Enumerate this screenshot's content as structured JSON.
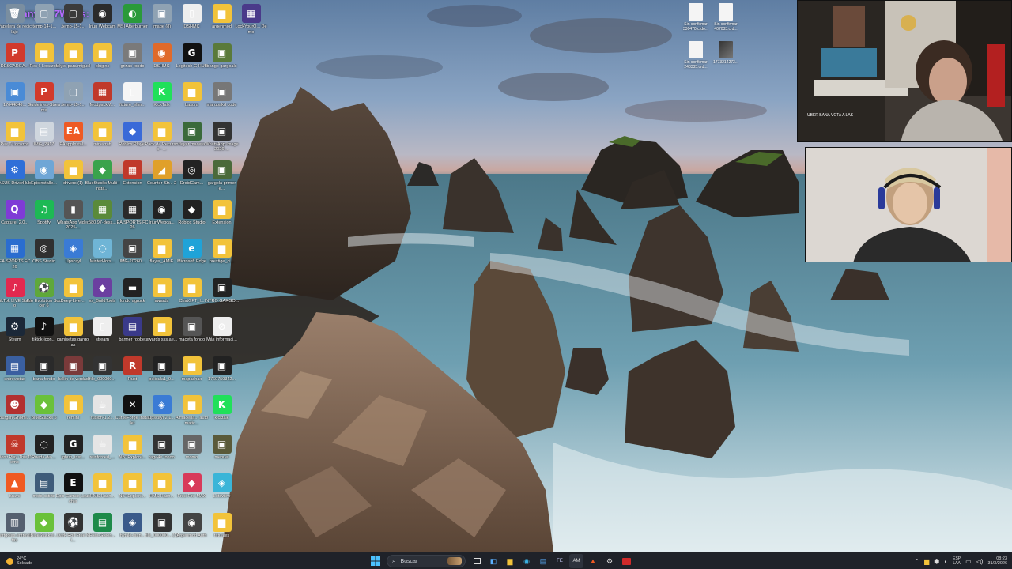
{
  "stream_overlay": {
    "title": "Danyel17Ways:"
  },
  "desktop_icons": [
    {
      "label": "Papelera de reciclaje",
      "color": "#7a8ea0",
      "glyph": "🗑"
    },
    {
      "label": "DESCARGA...",
      "color": "#d23a2c",
      "glyph": "P"
    },
    {
      "label": "17644846...",
      "color": "#4a8bd6",
      "glyph": "▣"
    },
    {
      "label": "Pes 6 Locazos",
      "color": "#f2c33a",
      "glyph": "▆"
    },
    {
      "label": "ASUS DriverHub",
      "color": "#2f6fd8",
      "glyph": "⚙"
    },
    {
      "label": "Capture_2.0...",
      "color": "#7f3bd6",
      "glyph": "Q"
    },
    {
      "label": "EA SPORTS FC 26",
      "color": "#2a6dcf",
      "glyph": "▦"
    },
    {
      "label": "TikTok LIVE Studio",
      "color": "#e2294f",
      "glyph": "♪"
    },
    {
      "label": "Steam",
      "color": "#1b2838",
      "glyph": "⚙"
    },
    {
      "label": "entrevistas",
      "color": "#3a5fa0",
      "glyph": "▤"
    },
    {
      "label": "Burglin Gnomi...",
      "color": "#b23030",
      "glyph": "☻"
    },
    {
      "label": "Don't Play This Demo",
      "color": "#c0392b",
      "glyph": "☠"
    },
    {
      "label": "Brave",
      "color": "#f05a22",
      "glyph": "▲"
    },
    {
      "label": "gartgolas entrevistas",
      "color": "#556070",
      "glyph": "▥"
    },
    {
      "label": ".temp-14-1...",
      "color": "#8fa2b3",
      "glyph": "▢"
    },
    {
      "label": "Pes 6 Locazos",
      "color": "#f2c33a",
      "glyph": "▆"
    },
    {
      "label": "Guidelines-Streams",
      "color": "#d23a2c",
      "glyph": "P"
    },
    {
      "label": "IMG_2417",
      "color": "#cfd6de",
      "glyph": "▤"
    },
    {
      "label": "EpicInstalle...",
      "color": "#6fa6d6",
      "glyph": "◉"
    },
    {
      "label": "Spotify",
      "color": "#1db954",
      "glyph": "♫"
    },
    {
      "label": "OBS Studio",
      "color": "#303030",
      "glyph": "◎"
    },
    {
      "label": "Pro Evolution Soccer 6",
      "color": "#5fa83a",
      "glyph": "⚽"
    },
    {
      "label": "tiktok-icon...",
      "color": "#111111",
      "glyph": "♪"
    },
    {
      "label": "bana fondo",
      "color": "#2a2a2a",
      "glyph": "▣"
    },
    {
      "label": "BlueStacks 5",
      "color": "#6ac13a",
      "glyph": "◆"
    },
    {
      "label": "Rueda-de-...",
      "color": "#222222",
      "glyph": "◌"
    },
    {
      "label": "mofo cstirts",
      "color": "#3f5c7a",
      "glyph": "▤"
    },
    {
      "label": "BlueStacksI...",
      "color": "#6ac13a",
      "glyph": "◆"
    },
    {
      "label": ".temp-15-1...",
      "color": "#3b3b3b",
      "glyph": "▢"
    },
    {
      "label": "falyer para miguel",
      "color": "#f2c33a",
      "glyph": "▆"
    },
    {
      "label": ".temp-15-1...",
      "color": "#8fa2b3",
      "glyph": "▢"
    },
    {
      "label": "EAappInstal...",
      "color": "#ee5a24",
      "glyph": "EA"
    },
    {
      "label": "drivers (1)",
      "color": "#f2c33a",
      "glyph": "▆"
    },
    {
      "label": "WhatsApp Video 2025-...",
      "color": "#555555",
      "glyph": "▮"
    },
    {
      "label": "Upscayl",
      "color": "#3a7bd5",
      "glyph": "◈"
    },
    {
      "label": "Deep-Live-...",
      "color": "#f2c33a",
      "glyph": "▆"
    },
    {
      "label": "camisetas gargolas",
      "color": "#f2c33a",
      "glyph": "▆"
    },
    {
      "label": "ballin de verdad",
      "color": "#7a3a3a",
      "glyph": "▣"
    },
    {
      "label": "remini",
      "color": "#f2c33a",
      "glyph": "▆"
    },
    {
      "label": "lghub_inst...",
      "color": "#222222",
      "glyph": "G"
    },
    {
      "label": "Epic Games Launcher",
      "color": "#111111",
      "glyph": "E"
    },
    {
      "label": "Dark Roll Free Ki...",
      "color": "#333333",
      "glyph": "⚽"
    },
    {
      "label": "Iriun Webcam",
      "color": "#2b2b2b",
      "glyph": "◉"
    },
    {
      "label": "plugins",
      "color": "#f2c33a",
      "glyph": "▆"
    },
    {
      "label": "ModpackM...",
      "color": "#c0392b",
      "glyph": "▦"
    },
    {
      "label": "minecraft",
      "color": "#f2c33a",
      "glyph": "▆"
    },
    {
      "label": "BlueStacks Multi-Insta...",
      "color": "#3aa34c",
      "glyph": "◆"
    },
    {
      "label": "580,97-desk...",
      "color": "#5a8a3a",
      "glyph": "▦"
    },
    {
      "label": "MinterHors...",
      "color": "#6fb5d6",
      "glyph": "◌"
    },
    {
      "label": "vs_BuildTools",
      "color": "#6b3fa0",
      "glyph": "◆"
    },
    {
      "label": "stream",
      "color": "#eeeeee",
      "glyph": "▯"
    },
    {
      "label": "file_000000...",
      "color": "#333333",
      "glyph": "▣"
    },
    {
      "label": "fusion-1.2...",
      "color": "#e5e5e5",
      "glyph": "☕"
    },
    {
      "label": "reinforced_...",
      "color": "#e5e5e5",
      "glyph": "☕"
    },
    {
      "label": "HMS.Hash...",
      "color": "#f2c33a",
      "glyph": "▆"
    },
    {
      "label": "Free-Green...",
      "color": "#1e8a4a",
      "glyph": "▤"
    },
    {
      "label": "MSI Afterburner",
      "color": "#2a9a3a",
      "glyph": "◐"
    },
    {
      "label": "grizas fondo",
      "color": "#7a7a7a",
      "glyph": "▣"
    },
    {
      "label": "fixture_elim...",
      "color": "#f5f5f5",
      "glyph": "▯"
    },
    {
      "label": "Roblox Player",
      "color": "#3a6ad8",
      "glyph": "◆"
    },
    {
      "label": "Extension",
      "color": "#c0392b",
      "glyph": "▦"
    },
    {
      "label": "EA SPORTS FC 26",
      "color": "#2a2a2a",
      "glyph": "▦"
    },
    {
      "label": "IMG-20260...",
      "color": "#444444",
      "glyph": "▣"
    },
    {
      "label": "fondo agruck",
      "color": "#222222",
      "glyph": "▬"
    },
    {
      "label": "banner roobet",
      "color": "#3a3a8a",
      "glyph": "▤"
    },
    {
      "label": "Rust",
      "color": "#c0392b",
      "glyph": "R"
    },
    {
      "label": "CurseForge Installer",
      "color": "#111111",
      "glyph": "✕"
    },
    {
      "label": "NBTExplore...",
      "color": "#f2c33a",
      "glyph": "▆"
    },
    {
      "label": "NBTExplore...",
      "color": "#f2c33a",
      "glyph": "▆"
    },
    {
      "label": "hytale-laun...",
      "color": "#3a5a8a",
      "glyph": "◈"
    },
    {
      "label": "image (8)",
      "color": "#8fa2b3",
      "glyph": "▣"
    },
    {
      "label": "DSHMC",
      "color": "#e06a2a",
      "glyph": "◉"
    },
    {
      "label": "KickTalk",
      "color": "#20e05a",
      "glyph": "K"
    },
    {
      "label": "Pack de Recursos - ...",
      "color": "#f2c33a",
      "glyph": "▆"
    },
    {
      "label": "Counter-Str... 2",
      "color": "#e0a02a",
      "glyph": "◢"
    },
    {
      "label": "IriunWebca...",
      "color": "#222222",
      "glyph": "◉"
    },
    {
      "label": "flayer_AMIE",
      "color": "#f2c33a",
      "glyph": "▆"
    },
    {
      "label": "awards",
      "color": "#f2c33a",
      "glyph": "▆"
    },
    {
      "label": "awards sss.ae...",
      "color": "#f2c33a",
      "glyph": "▆"
    },
    {
      "label": "pelicula1_9...",
      "color": "#222222",
      "glyph": "▣"
    },
    {
      "label": "upscayl-2.1...",
      "color": "#3a7bd5",
      "glyph": "◈"
    },
    {
      "label": "rage4e fondo",
      "color": "#333333",
      "glyph": "▣"
    },
    {
      "label": "HMS.Hash...",
      "color": "#f2c33a",
      "glyph": "▆"
    },
    {
      "label": "file_000000... (1)",
      "color": "#333333",
      "glyph": "▣"
    },
    {
      "label": "DSHMC",
      "color": "#eeeeee",
      "glyph": "▯"
    },
    {
      "label": "Logitech G HUB",
      "color": "#111111",
      "glyph": "G"
    },
    {
      "label": "basura",
      "color": "#f2c33a",
      "glyph": "▆"
    },
    {
      "label": "flayer maceta",
      "color": "#3a6a3a",
      "glyph": "▣"
    },
    {
      "label": "DroidCam...",
      "color": "#222222",
      "glyph": "◎"
    },
    {
      "label": "Roblox Studio",
      "color": "#222222",
      "glyph": "◆"
    },
    {
      "label": "Microsoft Edge",
      "color": "#1fa3d8",
      "glyph": "e"
    },
    {
      "label": "ChatGPT_I...",
      "color": "#f2c33a",
      "glyph": "▆"
    },
    {
      "label": "maceta fondo",
      "color": "#555555",
      "glyph": "▣"
    },
    {
      "label": "mapashax",
      "color": "#f2c33a",
      "glyph": "▆"
    },
    {
      "label": "Almacena... automatic...",
      "color": "#f2c33a",
      "glyph": "▆"
    },
    {
      "label": "momo",
      "color": "#666666",
      "glyph": "▣"
    },
    {
      "label": "Free Fire MAX",
      "color": "#d83a5a",
      "glyph": "◆"
    },
    {
      "label": "Argenmod Auth",
      "color": "#444444",
      "glyph": "◉"
    },
    {
      "label": "argenmod",
      "color": "#f2c33a",
      "glyph": "▆"
    },
    {
      "label": "bango gargoals",
      "color": "#5a7a3a",
      "glyph": "▣"
    },
    {
      "label": "maruoakd code",
      "color": "#777777",
      "glyph": "▣"
    },
    {
      "label": "WhatsApp Image 2026-...",
      "color": "#333333",
      "glyph": "▣"
    },
    {
      "label": "gargola primer e...",
      "color": "#4a6a3a",
      "glyph": "▣"
    },
    {
      "label": "Extension",
      "color": "#f2c33a",
      "glyph": "▆"
    },
    {
      "label": "prestige_ci...",
      "color": "#f2c33a",
      "glyph": "▆"
    },
    {
      "label": "INTRO GARGO...",
      "color": "#222222",
      "glyph": "▣"
    },
    {
      "label": "Más informaci...",
      "color": "#eeeeee",
      "glyph": "⊘"
    },
    {
      "label": "1769759342...",
      "color": "#222222",
      "glyph": "▣"
    },
    {
      "label": "kicktalk",
      "color": "#20e05a",
      "glyph": "K"
    },
    {
      "label": "menuel",
      "color": "#5a5a3a",
      "glyph": "▣"
    },
    {
      "label": "Letsview",
      "color": "#3ab5d8",
      "glyph": "◈"
    },
    {
      "label": "tatuajes",
      "color": "#f2c33a",
      "glyph": "▆"
    },
    {
      "label": "LockYourO... Demo",
      "color": "#4a3a8a",
      "glyph": "▦"
    }
  ],
  "right_files": [
    {
      "label": "Sin confirmar 330470.crdo...",
      "type": "doc"
    },
    {
      "label": "Sin confirmar 407033.crd...",
      "type": "doc"
    },
    {
      "label": "Sin confirmar 243335.crd...",
      "type": "doc"
    },
    {
      "label": "1773214273...",
      "type": "img"
    }
  ],
  "webcam_overlay": {
    "banner_text": "UBER BANA VOTA A LAS"
  },
  "taskbar": {
    "weather_temp": "24°C",
    "weather_desc": "Soleado",
    "search_placeholder": "Buscar",
    "lang_top": "ESP",
    "lang_bottom": "LAA",
    "time": "08:23",
    "date": "31/3/2026"
  }
}
